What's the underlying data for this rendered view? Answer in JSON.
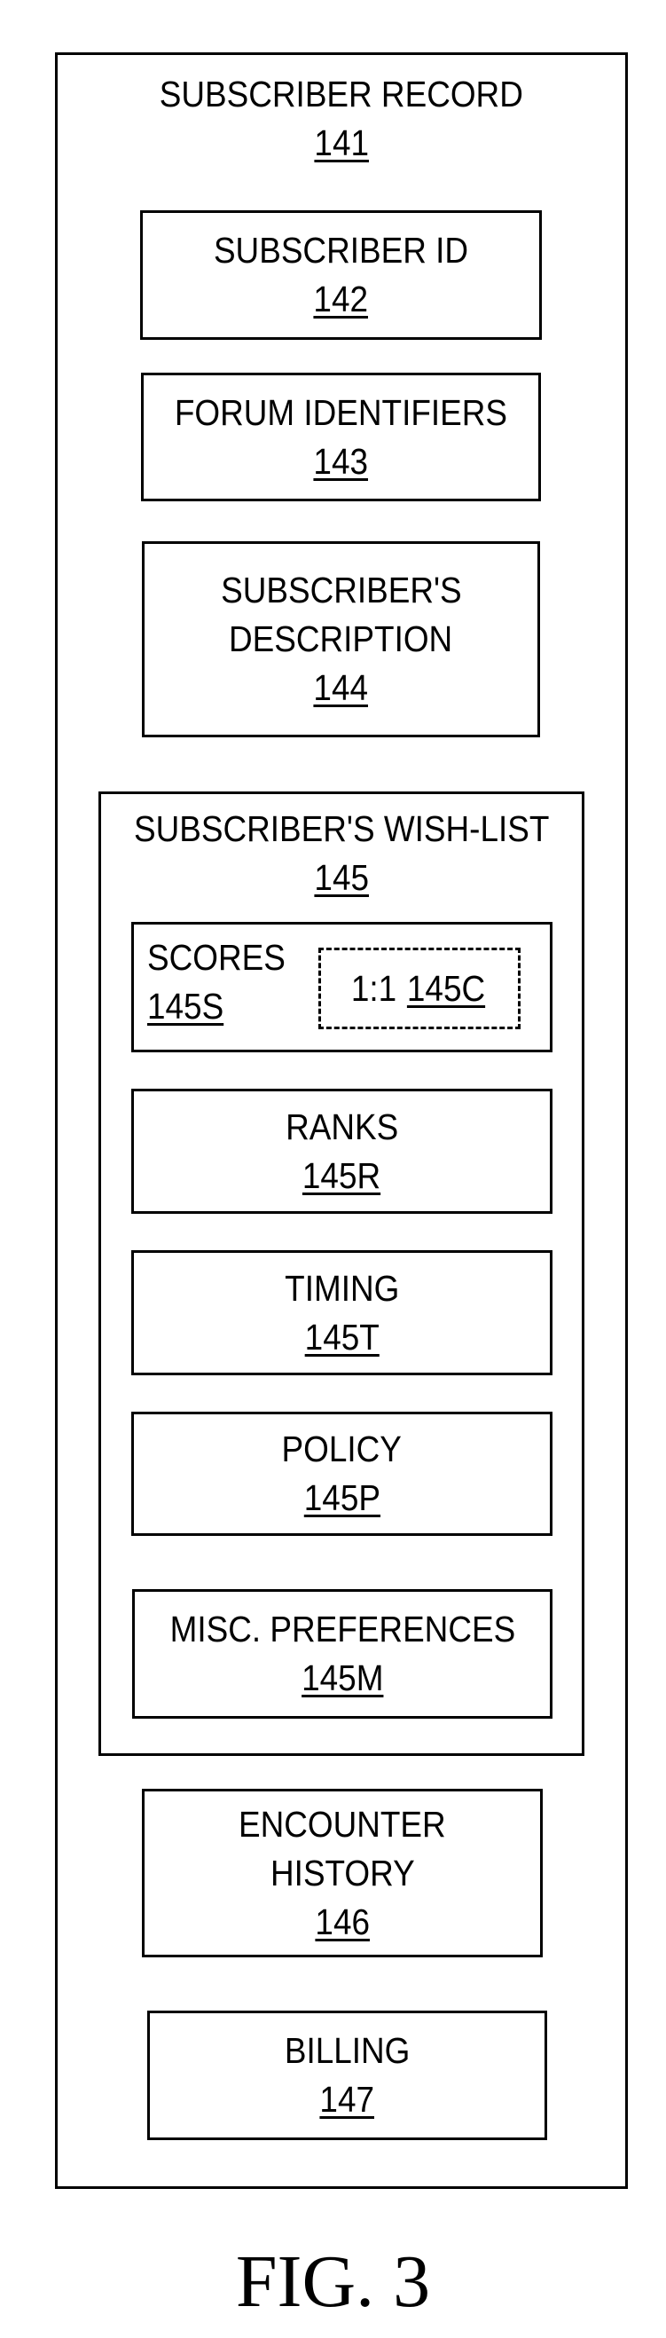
{
  "figure": {
    "label": "FIG. 3"
  },
  "record": {
    "title": "SUBSCRIBER RECORD",
    "ref": "141",
    "subscriber_id": {
      "label": "SUBSCRIBER ID",
      "ref": "142"
    },
    "forum_identifiers": {
      "label": "FORUM IDENTIFIERS",
      "ref": "143"
    },
    "description": {
      "label_lines": [
        "SUBSCRIBER'S",
        "DESCRIPTION"
      ],
      "ref": "144"
    },
    "wish_list": {
      "title": "SUBSCRIBER'S WISH-LIST",
      "ref": "145",
      "scores": {
        "label": "SCORES",
        "ref": "145S",
        "component": {
          "prefix": "1:1",
          "ref": "145C"
        }
      },
      "ranks": {
        "label": "RANKS",
        "ref": "145R"
      },
      "timing": {
        "label": "TIMING",
        "ref": "145T"
      },
      "policy": {
        "label": "POLICY",
        "ref": "145P"
      },
      "misc_preferences": {
        "label": "MISC. PREFERENCES",
        "ref": "145M"
      }
    },
    "encounter_history": {
      "label_lines": [
        "ENCOUNTER",
        "HISTORY"
      ],
      "ref": "146"
    },
    "billing": {
      "label": "BILLING",
      "ref": "147"
    }
  }
}
